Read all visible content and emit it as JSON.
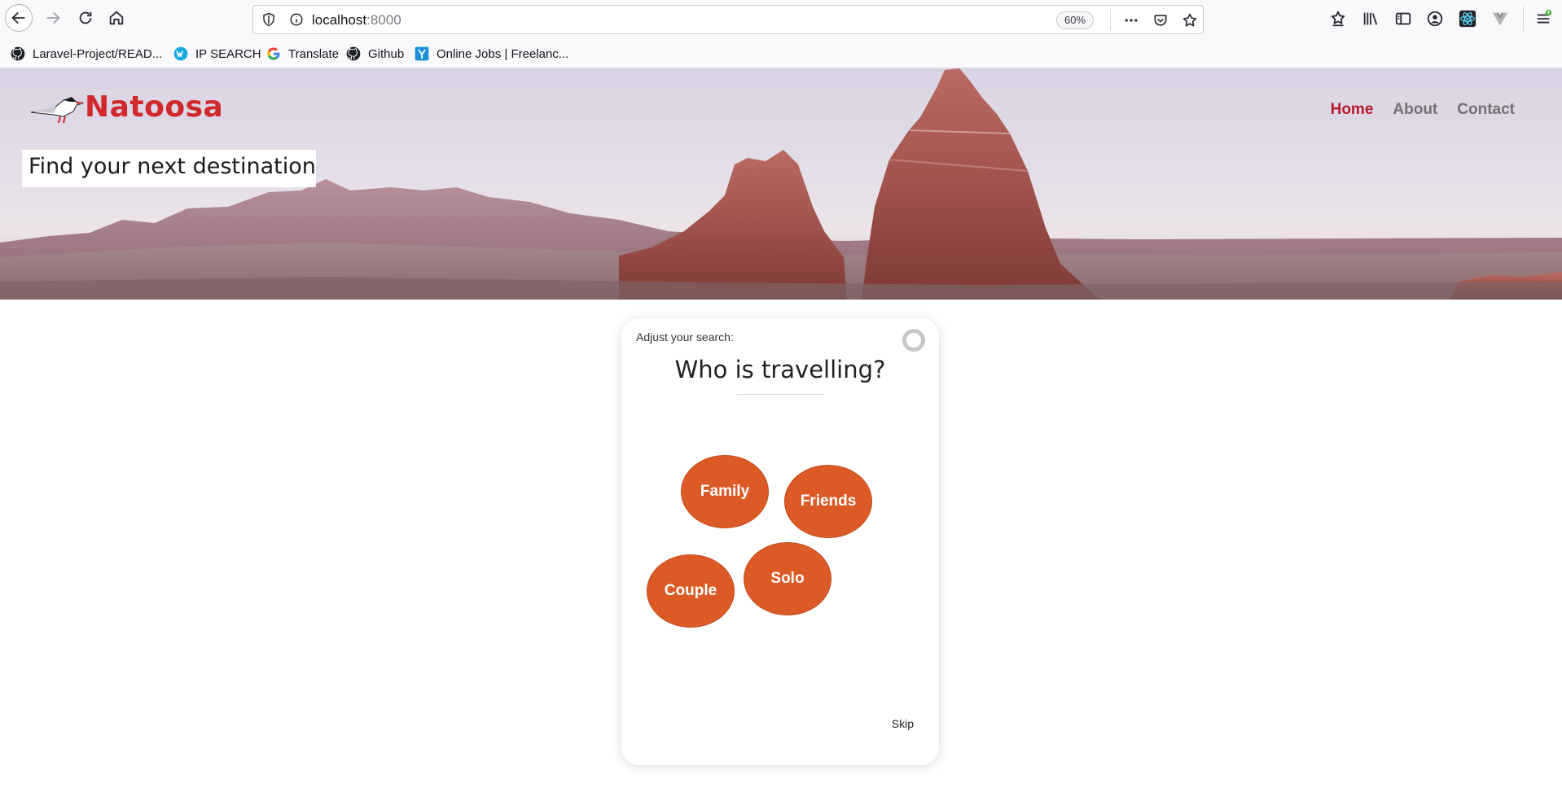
{
  "browser": {
    "url_host": "localhost",
    "url_port": ":8000",
    "zoom": "60%",
    "bookmarks": [
      {
        "label": "Laravel-Project/READ...",
        "icon": "github-icon"
      },
      {
        "label": "IP SEARCH",
        "icon": "whatismyip-icon"
      },
      {
        "label": "Translate",
        "icon": "google-icon"
      },
      {
        "label": "Github",
        "icon": "github-icon"
      },
      {
        "label": "Online Jobs | Freelanc...",
        "icon": "upwork-icon"
      }
    ]
  },
  "site": {
    "brand": "Natoosa",
    "brand_color": "#d0282c",
    "nav": [
      {
        "label": "Home",
        "active": true
      },
      {
        "label": "About",
        "active": false
      },
      {
        "label": "Contact",
        "active": false
      }
    ],
    "hero_title": "Find your next destination"
  },
  "search_card": {
    "hint": "Adjust your search:",
    "question": "Who is travelling?",
    "options": [
      "Family",
      "Friends",
      "Couple",
      "Solo"
    ],
    "option_color": "#dc5a25",
    "skip_label": "Skip"
  }
}
